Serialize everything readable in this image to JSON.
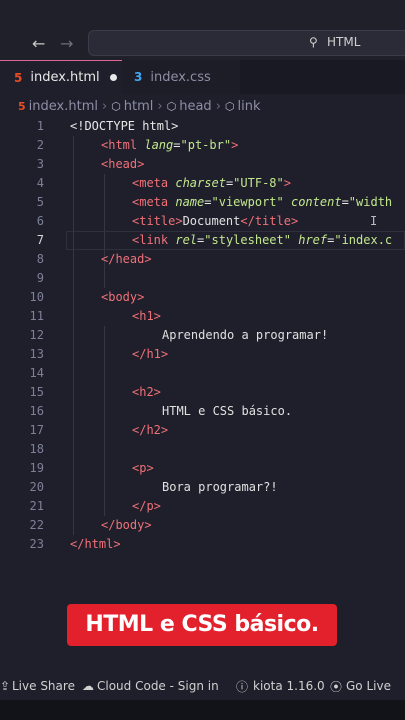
{
  "search": {
    "label": "HTML"
  },
  "tabs": [
    {
      "label": "index.html",
      "icon": "5"
    },
    {
      "label": "index.css",
      "icon": "3"
    }
  ],
  "breadcrumb": [
    "index.html",
    "html",
    "head",
    "link"
  ],
  "code_lines": [
    {
      "n": "1"
    },
    {
      "n": "2"
    },
    {
      "n": "3"
    },
    {
      "n": "4"
    },
    {
      "n": "5"
    },
    {
      "n": "6"
    },
    {
      "n": "7"
    },
    {
      "n": "8"
    },
    {
      "n": "9"
    },
    {
      "n": "10"
    },
    {
      "n": "11"
    },
    {
      "n": "12"
    },
    {
      "n": "13"
    },
    {
      "n": "14"
    },
    {
      "n": "15"
    },
    {
      "n": "16"
    },
    {
      "n": "17"
    },
    {
      "n": "18"
    },
    {
      "n": "19"
    },
    {
      "n": "20"
    },
    {
      "n": "21"
    },
    {
      "n": "22"
    },
    {
      "n": "23"
    }
  ],
  "code": {
    "l1": "<!DOCTYPE html>",
    "l2_tag": "<html",
    "l2_attr": "lang",
    "l2_val": "\"pt-br\"",
    "l3": "<head>",
    "l4_tag": "<meta",
    "l4_attr": "charset",
    "l4_val": "\"UTF-8\"",
    "l5_tag": "<meta",
    "l5_attr1": "name",
    "l5_val1": "\"viewport\"",
    "l5_attr2": "content",
    "l5_val2": "\"width",
    "l6_open": "<title>",
    "l6_text": "Document",
    "l6_close": "</title>",
    "l7_tag": "<link",
    "l7_attr1": "rel",
    "l7_val1": "\"stylesheet\"",
    "l7_attr2": "href",
    "l7_val2": "\"index.c",
    "l8": "</head>",
    "l10": "<body>",
    "l11": "<h1>",
    "l12": "Aprendendo a programar!",
    "l13": "</h1>",
    "l15": "<h2>",
    "l16": "HTML e CSS básico.",
    "l17": "</h2>",
    "l19": "<p>",
    "l20": "Bora programar?!",
    "l21": "</p>",
    "l22": "</body>",
    "l23": "</html>"
  },
  "caption": "HTML e CSS básico.",
  "status": {
    "live_share": "Live Share",
    "cloud_code": "Cloud Code - Sign in",
    "kiota": "kiota 1.16.0",
    "go_live": "Go Live"
  },
  "colors": {
    "caption_bg": "#e3212d",
    "tag": "#f07178",
    "attr_value": "#c3e88d",
    "html_icon": "#e44d26",
    "css_icon": "#42a5f5"
  }
}
